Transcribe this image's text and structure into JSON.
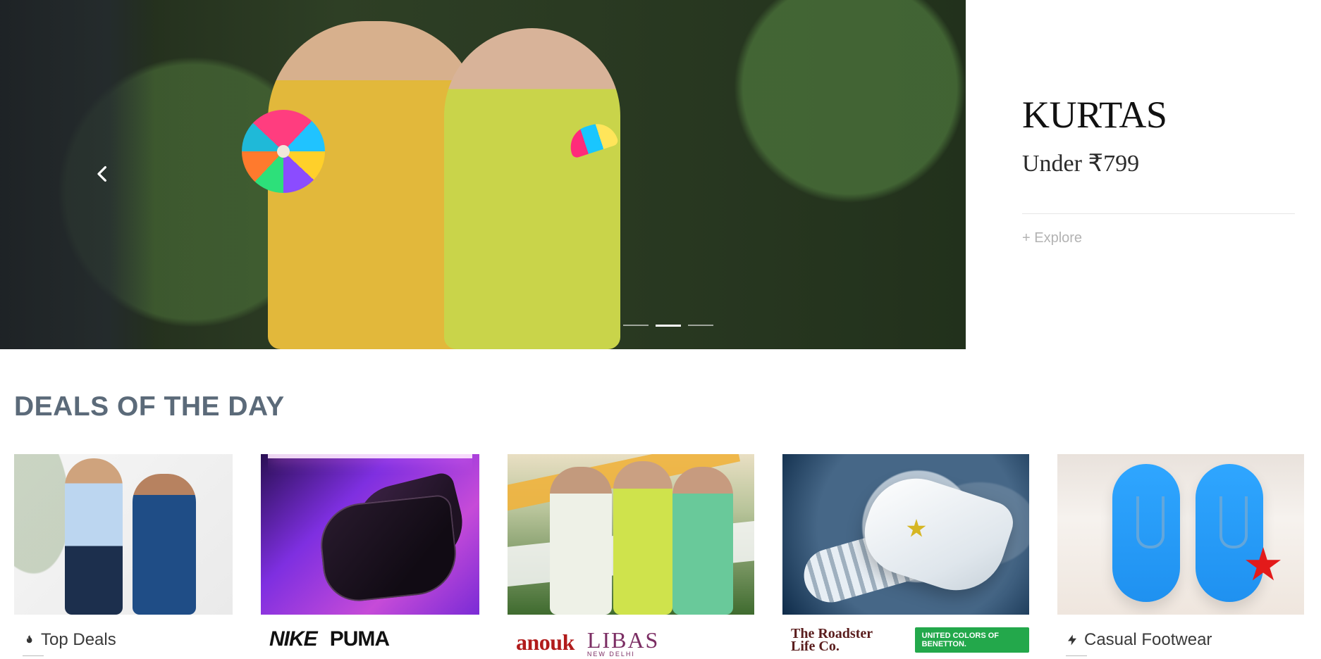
{
  "hero": {
    "promo": {
      "title": "KURTAS",
      "subtitle": "Under ₹799",
      "cta": "+ Explore"
    }
  },
  "deals": {
    "title": "DEALS OF THE DAY",
    "cards": [
      {
        "label": "Top Deals",
        "icon": "flame-icon"
      },
      {
        "brands": [
          "NIKE",
          "PUMA"
        ]
      },
      {
        "brands": [
          "anouk",
          "LIBAS"
        ],
        "libas_sub": "NEW DELHI"
      },
      {
        "brands": [
          "The Roadster Life Co.",
          "UNITED COLORS OF BENETTON."
        ]
      },
      {
        "label": "Casual Footwear",
        "icon": "lightning-icon"
      }
    ]
  }
}
